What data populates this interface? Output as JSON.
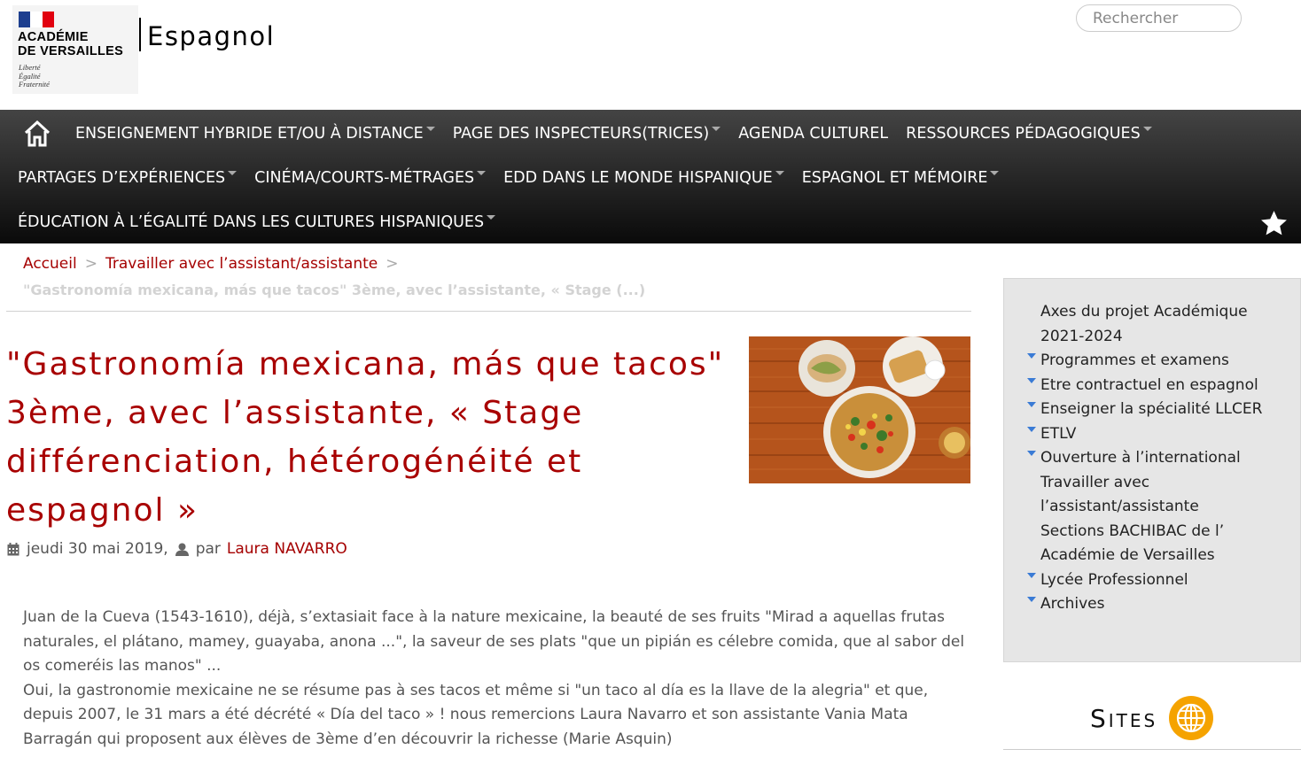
{
  "header": {
    "logo_line1": "ACADÉMIE",
    "logo_line2": "DE VERSAILLES",
    "logo_motto": [
      "Liberté",
      "Égalité",
      "Fraternité"
    ],
    "site_name": "Espagnol",
    "search_placeholder": "Rechercher"
  },
  "nav": {
    "home_icon": "home-icon",
    "row1": [
      {
        "label": "ENSEIGNEMENT HYBRIDE ET/OU À DISTANCE",
        "dropdown": true
      },
      {
        "label": "PAGE DES INSPECTEURS(TRICES)",
        "dropdown": true
      },
      {
        "label": "AGENDA CULTUREL",
        "dropdown": false
      },
      {
        "label": "RESSOURCES PÉDAGOGIQUES",
        "dropdown": true
      }
    ],
    "row2": [
      {
        "label": "PARTAGES D’EXPÉRIENCES",
        "dropdown": true
      },
      {
        "label": "CINÉMA/COURTS-MÉTRAGES",
        "dropdown": true
      },
      {
        "label": "EDD DANS LE MONDE HISPANIQUE",
        "dropdown": true
      },
      {
        "label": "ESPAGNOL ET MÉMOIRE",
        "dropdown": true
      }
    ],
    "row3": [
      {
        "label": "ÉDUCATION À L’ÉGALITÉ DANS LES CULTURES HISPANIQUES",
        "dropdown": true
      }
    ],
    "star_icon": "star-icon"
  },
  "breadcrumb": {
    "home": "Accueil",
    "section": "Travailler avec l’assistant/assistante",
    "sep": ">",
    "current": "\"Gastronomía mexicana, más que tacos\" 3ème, avec l’assistante, « Stage (...)"
  },
  "article": {
    "title": "\"Gastronomía mexicana, más que tacos\" 3ème, avec l’assistante, « Stage différenciation, hétérogénéité et espagnol »",
    "date": "jeudi 30 mai 2019,",
    "by": "par",
    "author": "Laura NAVARRO",
    "paragraph1": "Juan de la Cueva (1543-1610), déjà, s’extasiait face à la nature mexicaine, la beauté de ses fruits \"Mirad a aquellas frutas naturales, el plátano, mamey, guayaba, anona ...\", la saveur de ses plats \"que un pipián es célebre comida, que al sabor del os comeréis las manos\" ...",
    "paragraph2": "Oui, la gastronomie mexicaine ne se résume pas à ses tacos et même si \"un taco al día es la llave de la alegria\" et que, depuis 2007, le 31 mars a été décrété « Día del taco » ! nous remercions Laura Navarro et son assistante Vania Mata Barragán qui proposent aux élèves de 3ème d’en découvrir la richesse (Marie Asquin)"
  },
  "sidebar": {
    "items": [
      {
        "label": "Axes du projet Académique 2021-2024",
        "expandable": false
      },
      {
        "label": "Programmes et examens",
        "expandable": true
      },
      {
        "label": "Etre contractuel en espagnol",
        "expandable": true
      },
      {
        "label": "Enseigner la spécialité LLCER",
        "expandable": true
      },
      {
        "label": "ETLV",
        "expandable": true
      },
      {
        "label": "Ouverture à l’international",
        "expandable": true
      },
      {
        "label": "Travailler avec l’assistant/assistante",
        "expandable": false
      },
      {
        "label": "Sections BACHIBAC de l’ Académie de Versailles",
        "expandable": false
      },
      {
        "label": "Lycée Professionnel",
        "expandable": true
      },
      {
        "label": "Archives",
        "expandable": true
      }
    ],
    "sites_title": "Sites",
    "sites_icon": "globe-icon"
  },
  "colors": {
    "accent": "#a80000",
    "nav_top": "#444444",
    "nav_bottom": "#0a0a0a",
    "sidebar_bg": "#e6e6e6",
    "globe": "#f5a300"
  }
}
